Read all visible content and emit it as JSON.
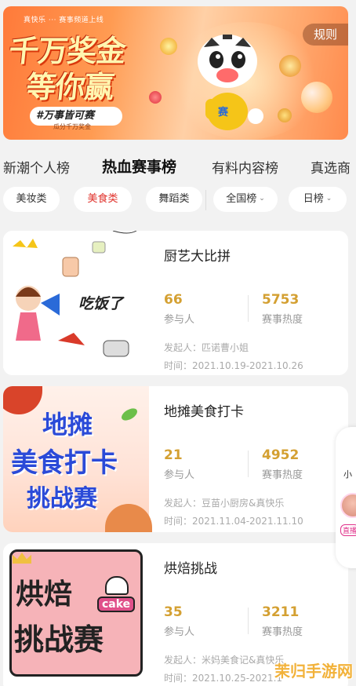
{
  "banner": {
    "topline": "真快乐 ··· 赛事频道上线",
    "slogan_line1": "千万奖金",
    "slogan_line2": "等你赢",
    "pill_text": "#万事皆可赛",
    "pill_sub": "瓜分千万奖金",
    "rules_label": "规则",
    "tiger_badge": "赛"
  },
  "tabs": [
    {
      "label": "新潮个人榜",
      "active": false
    },
    {
      "label": "热血赛事榜",
      "active": true
    },
    {
      "label": "有料内容榜",
      "active": false
    },
    {
      "label": "真选商",
      "active": false
    }
  ],
  "filters": {
    "categories": [
      {
        "label": "美妆类",
        "active": false
      },
      {
        "label": "美食类",
        "active": true
      },
      {
        "label": "舞蹈类",
        "active": false
      }
    ],
    "region": "全国榜",
    "period": "日榜"
  },
  "cards": [
    {
      "title": "厨艺大比拼",
      "participants": "66",
      "participants_label": "参与人",
      "heat": "5753",
      "heat_label": "赛事热度",
      "sponsor": "发起人：匹诺曹小姐",
      "dates": "时间：2021.10.19-2021.10.26",
      "thumb_text": "吃饭了"
    },
    {
      "title": "地摊美食打卡",
      "participants": "21",
      "participants_label": "参与人",
      "heat": "4952",
      "heat_label": "赛事热度",
      "sponsor": "发起人：豆苗小厨房&真快乐",
      "dates": "时间：2021.11.04-2021.11.10",
      "thumb_line1": "地摊",
      "thumb_line2": "美食打卡",
      "thumb_line3": "挑战赛"
    },
    {
      "title": "烘焙挑战",
      "participants": "35",
      "participants_label": "参与人",
      "heat": "3211",
      "heat_label": "赛事热度",
      "sponsor": "发起人：米妈美食记&真快乐",
      "dates": "时间：2021.10.25-2021.1",
      "thumb_line1": "烘焙",
      "thumb_line2": "挑战赛",
      "thumb_badge": "cake"
    }
  ],
  "float_panel": {
    "label": "小",
    "avatar_label": "直播"
  },
  "watermark": "茉归手游网",
  "icons": {
    "caret": "chevron-down-icon"
  }
}
